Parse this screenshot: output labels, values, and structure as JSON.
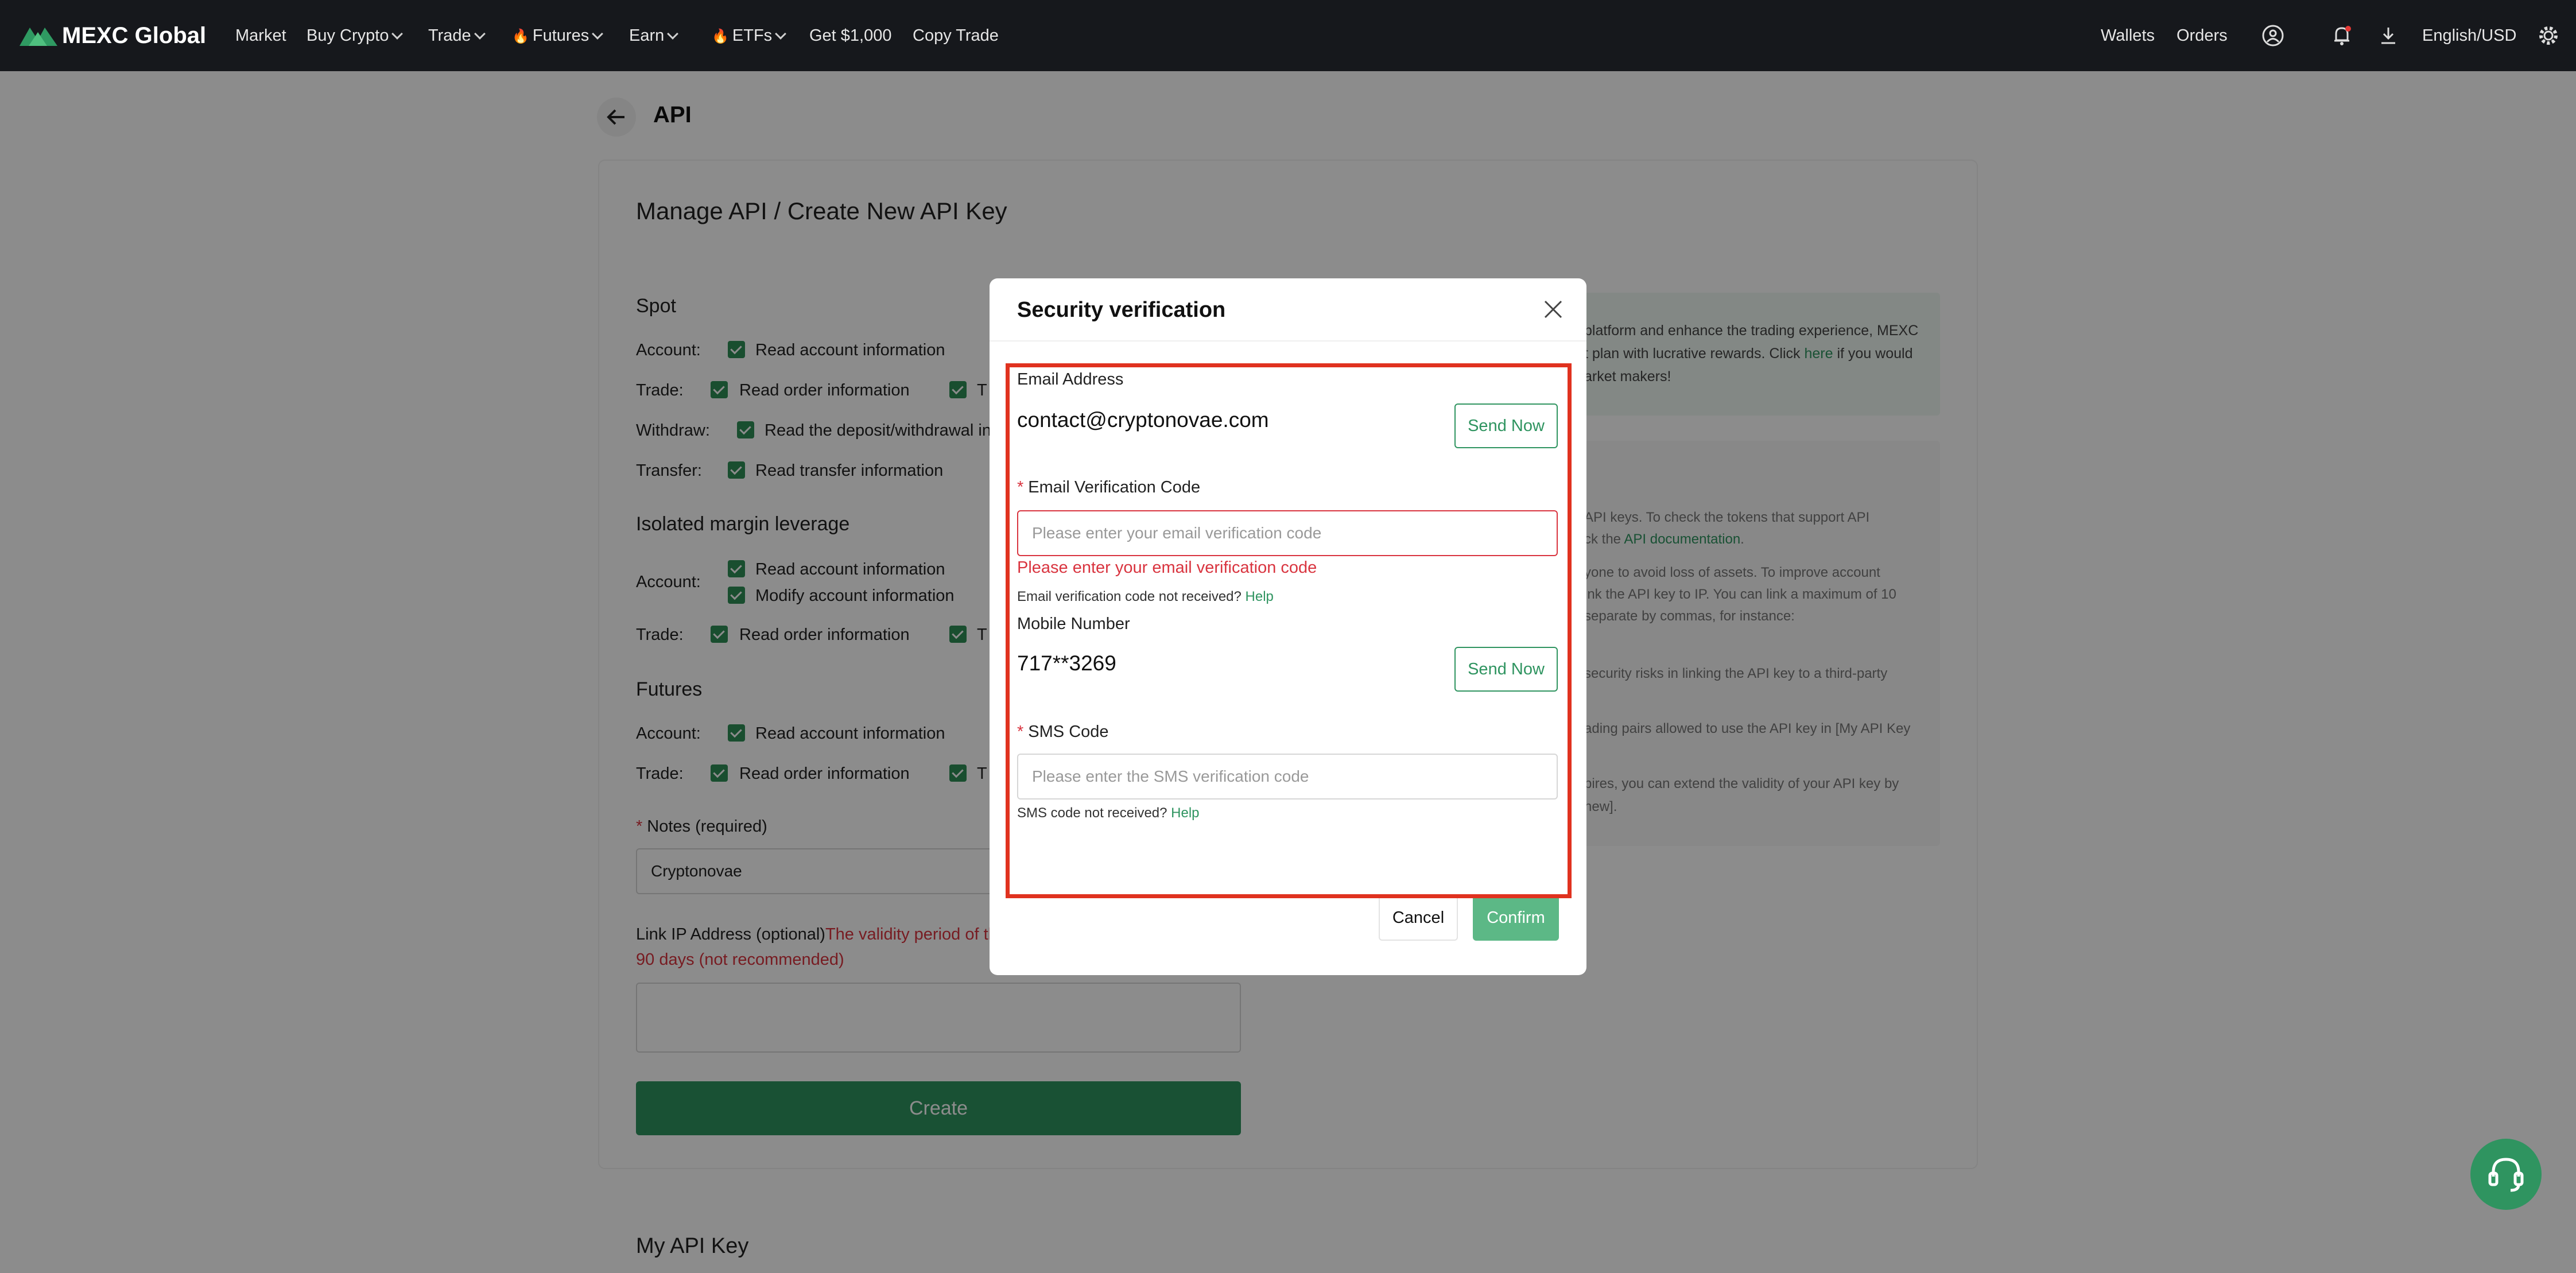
{
  "nav": {
    "logo_text": "MEXC Global",
    "items": [
      {
        "label": "Market"
      },
      {
        "label": "Buy Crypto"
      },
      {
        "label": "Trade"
      },
      {
        "label": "Futures"
      },
      {
        "label": "Earn"
      },
      {
        "label": "ETFs"
      },
      {
        "label": "Get $1,000"
      },
      {
        "label": "Copy Trade"
      }
    ],
    "right": {
      "wallets": "Wallets",
      "orders": "Orders",
      "language": "English/USD"
    },
    "icons": [
      "user-icon",
      "bell-icon",
      "download-icon",
      "gear-icon"
    ]
  },
  "page": {
    "title": "API",
    "card_title": "Manage API / Create New API Key",
    "spot": {
      "heading": "Spot",
      "account_label": "Account:",
      "account_opt": "Read account information",
      "trade_label": "Trade:",
      "trade_opt": "Read order information",
      "withdraw_label": "Withdraw:",
      "withdraw_opt": "Read the deposit/withdrawal inf",
      "transfer_label": "Transfer:",
      "transfer_opt": "Read transfer information"
    },
    "margin": {
      "heading": "Isolated margin leverage",
      "account_label": "Account:",
      "account_opt1": "Read account information",
      "account_opt2": "Modify account information",
      "trade_label": "Trade:",
      "trade_opt": "Read order information"
    },
    "futures": {
      "heading": "Futures",
      "account_label": "Account:",
      "account_opt": "Read account information",
      "trade_label": "Trade:",
      "trade_opt": "Read order information"
    },
    "partial_t": "T",
    "notes_label": "Notes (required)",
    "notes_value": "Cryptonovae",
    "ip_label": "Link IP Address (optional)",
    "ip_warning_1": "The validity period of the",
    "ip_warning_2": "90 days (not recommended)",
    "create_button": "Create",
    "my_api_key": "My API Key",
    "info_top": [
      "platform and enhance the trading experience, MEXC",
      "t plan with lucrative rewards. Click",
      "here",
      "if you would",
      "arket makers!"
    ],
    "info_notes": [
      "API keys. To check the tokens that support API",
      "ck the",
      "API documentation",
      ".",
      "yone to avoid loss of assets. To improve account",
      "ink the API key to IP. You can link a maximum of 10",
      "separate by commas, for instance:",
      "security risks in linking the API key to a third-party",
      "ading pairs allowed to use the API key in [My API Key",
      "pires, you can extend the validity of your API key by",
      "new]."
    ]
  },
  "modal": {
    "title": "Security verification",
    "email_label": "Email Address",
    "email_value": "contact@cryptonovae.com",
    "send_now": "Send Now",
    "email_code_label": "Email Verification Code",
    "email_code_placeholder": "Please enter your email verification code",
    "email_code_error": "Please enter your email verification code",
    "email_not_received": "Email verification code not received?",
    "help": "Help",
    "mobile_label": "Mobile Number",
    "mobile_value": "717**3269",
    "sms_label": "SMS Code",
    "sms_placeholder": "Please enter the SMS verification code",
    "sms_not_received": "SMS code not received?",
    "cancel": "Cancel",
    "confirm": "Confirm"
  },
  "colors": {
    "brand": "#2f9460",
    "error": "#d9343f",
    "highlight": "#e0321f"
  }
}
